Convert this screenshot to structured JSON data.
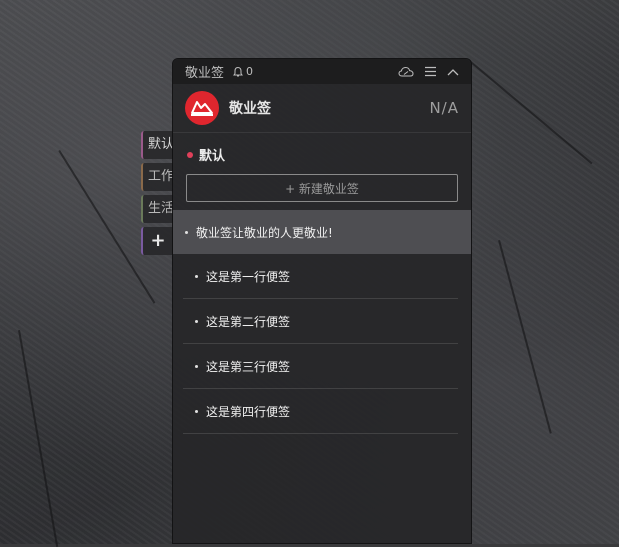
{
  "app": {
    "title": "敬业签",
    "notification_count": "0",
    "icons": [
      "bell-icon",
      "cloud-icon",
      "menu-icon",
      "collapse-icon"
    ]
  },
  "header": {
    "name": "敬业签",
    "status": "N/A"
  },
  "tabs": [
    {
      "label": "默认"
    },
    {
      "label": "工作"
    },
    {
      "label": "生活"
    },
    {
      "label": "+"
    }
  ],
  "category": {
    "label": "默认",
    "dot_color": "#e0405a"
  },
  "new_note_button": "+ 新建敬业签",
  "notes": [
    {
      "text": "敬业签让敬业的人更敬业!"
    },
    {
      "text": "这是第一行便签"
    },
    {
      "text": "这是第二行便签"
    },
    {
      "text": "这是第三行便签"
    },
    {
      "text": "这是第四行便签"
    }
  ],
  "colors": {
    "brand": "#e0262e",
    "panel_bg": "#262628"
  }
}
